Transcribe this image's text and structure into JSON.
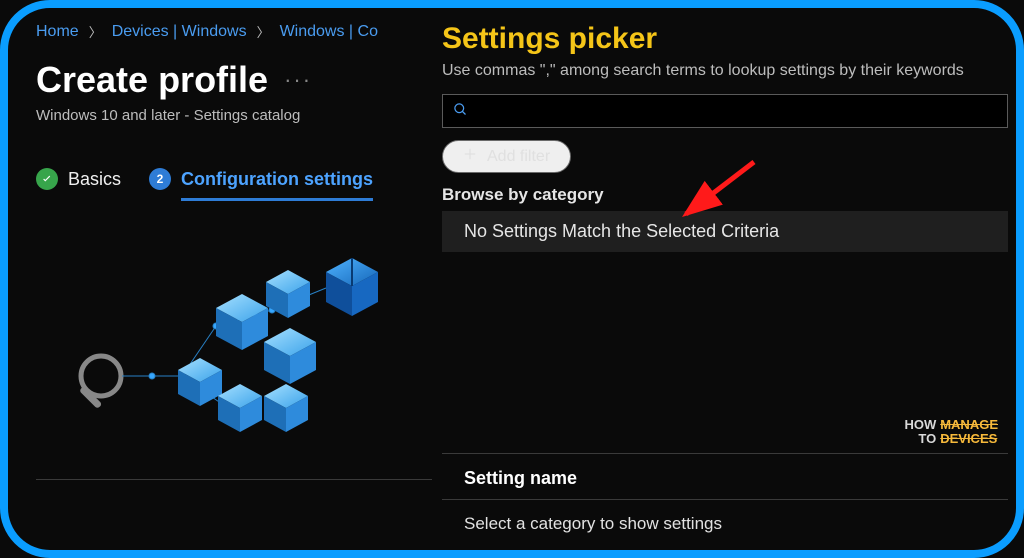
{
  "breadcrumbs": {
    "home": "Home",
    "devices": "Devices | Windows",
    "windows": "Windows | Co"
  },
  "left": {
    "title": "Create profile",
    "subtitle": "Windows 10 and later - Settings catalog"
  },
  "steps": {
    "basics_label": "Basics",
    "config_number": "2",
    "config_label": "Configuration settings"
  },
  "picker": {
    "title": "Settings picker",
    "subtitle": "Use commas \",\" among search terms to lookup settings by their keywords",
    "search_placeholder": "",
    "add_filter": "Add filter",
    "browse_label": "Browse by category",
    "no_match": "No Settings Match the Selected Criteria",
    "setting_name_header": "Setting name",
    "setting_name_empty": "Select a category to show settings"
  },
  "watermark": {
    "a1": "HOW",
    "a2": "TO",
    "b1": "MANAGE",
    "b2": "DEVICES"
  }
}
